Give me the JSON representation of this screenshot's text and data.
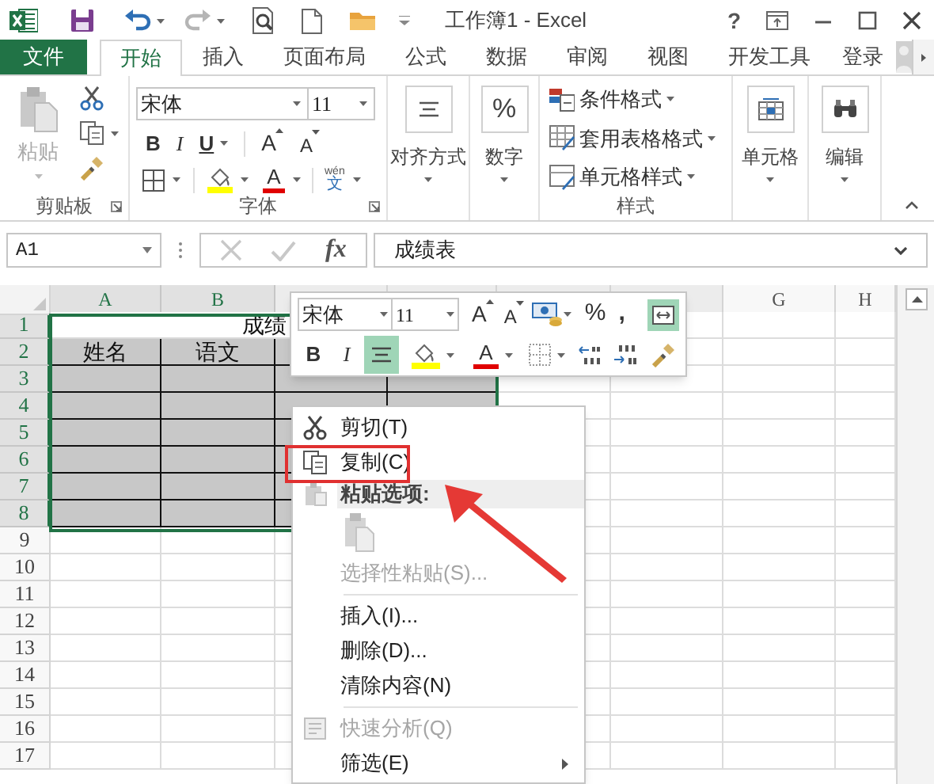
{
  "title_bar": {
    "title": "工作簿1 - Excel",
    "help": "?"
  },
  "ribbon_tabs": [
    {
      "label": "文件",
      "kind": "file",
      "selected": false
    },
    {
      "label": "开始",
      "kind": "tab",
      "selected": true
    },
    {
      "label": "插入",
      "kind": "tab",
      "selected": false
    },
    {
      "label": "页面布局",
      "kind": "tab",
      "selected": false
    },
    {
      "label": "公式",
      "kind": "tab",
      "selected": false
    },
    {
      "label": "数据",
      "kind": "tab",
      "selected": false
    },
    {
      "label": "审阅",
      "kind": "tab",
      "selected": false
    },
    {
      "label": "视图",
      "kind": "tab",
      "selected": false
    },
    {
      "label": "开发工具",
      "kind": "tab",
      "selected": false
    }
  ],
  "account": {
    "label": "登录"
  },
  "ribbon": {
    "clipboard": {
      "paste": "粘贴",
      "group_label": "剪贴板"
    },
    "font": {
      "font_name": "宋体",
      "font_size": "11",
      "bold": "B",
      "italic": "I",
      "underline": "U",
      "grow": "A",
      "shrink": "A",
      "font_color": "A",
      "phonetic_top": "wén",
      "phonetic_bottom": "文",
      "group_label": "字体"
    },
    "alignment": {
      "label": "对齐方式"
    },
    "number": {
      "glyph": "%",
      "label": "数字"
    },
    "styles": {
      "items": [
        "条件格式",
        "套用表格格式",
        "单元格样式"
      ],
      "group_label": "样式"
    },
    "cells": {
      "label": "单元格"
    },
    "editing": {
      "label": "编辑"
    }
  },
  "formula_bar": {
    "name_box": "A1",
    "fx": "fx",
    "value": "成绩表"
  },
  "sheet": {
    "columns": [
      {
        "label": "A",
        "selected": true
      },
      {
        "label": "B",
        "selected": true
      },
      {
        "kind": "covered"
      },
      {
        "kind": "covered"
      },
      {
        "kind": "covered"
      },
      {
        "kind": "covered"
      },
      {
        "label": "G",
        "selected": false
      },
      {
        "label": "H",
        "selected": false
      }
    ],
    "rows": [
      {
        "number": "1",
        "selected": true,
        "shaded": false,
        "merged_text": "成绩"
      },
      {
        "number": "2",
        "selected": true,
        "shaded": true,
        "cells": [
          "姓名",
          "语文"
        ]
      },
      {
        "number": "3",
        "selected": true,
        "shaded": true
      },
      {
        "number": "4",
        "selected": true,
        "shaded": true
      },
      {
        "number": "5",
        "selected": true,
        "shaded": true
      },
      {
        "number": "6",
        "selected": true,
        "shaded": true
      },
      {
        "number": "7",
        "selected": true,
        "shaded": true
      },
      {
        "number": "8",
        "selected": true,
        "shaded": true
      },
      {
        "number": "9",
        "selected": false,
        "shaded": false
      },
      {
        "number": "10",
        "selected": false,
        "shaded": false
      },
      {
        "number": "11",
        "selected": false,
        "shaded": false
      },
      {
        "number": "12",
        "selected": false,
        "shaded": false
      },
      {
        "number": "13",
        "selected": false,
        "shaded": false
      },
      {
        "number": "14",
        "selected": false,
        "shaded": false
      },
      {
        "number": "15",
        "selected": false,
        "shaded": false
      },
      {
        "number": "16",
        "selected": false,
        "shaded": false
      },
      {
        "number": "17",
        "selected": false,
        "shaded": false
      }
    ]
  },
  "mini_toolbar": {
    "font_name": "宋体",
    "font_size": "11",
    "grow": "A",
    "shrink": "A",
    "percent": "%",
    "comma": ",",
    "bold": "B",
    "italic": "I",
    "font_color": "A",
    "wrap_selected": true,
    "center_selected": true
  },
  "context_menu": {
    "items": [
      {
        "kind": "item",
        "label": "剪切(T)",
        "disabled": false,
        "annotated": false
      },
      {
        "kind": "item",
        "label": "复制(C)",
        "disabled": false,
        "annotated": true
      },
      {
        "kind": "header",
        "label": "粘贴选项:"
      },
      {
        "kind": "paste_icons"
      },
      {
        "kind": "item",
        "label": "选择性粘贴(S)...",
        "disabled": true,
        "annotated": false
      },
      {
        "kind": "separator"
      },
      {
        "kind": "item",
        "label": "插入(I)...",
        "disabled": false,
        "annotated": false
      },
      {
        "kind": "item",
        "label": "删除(D)...",
        "disabled": false,
        "annotated": false
      },
      {
        "kind": "item",
        "label": "清除内容(N)",
        "disabled": false,
        "annotated": false
      },
      {
        "kind": "separator"
      },
      {
        "kind": "item",
        "label": "快速分析(Q)",
        "disabled": true,
        "annotated": false
      },
      {
        "kind": "item",
        "label": "筛选(E)",
        "disabled": false,
        "annotated": false,
        "submenu": true
      }
    ]
  }
}
